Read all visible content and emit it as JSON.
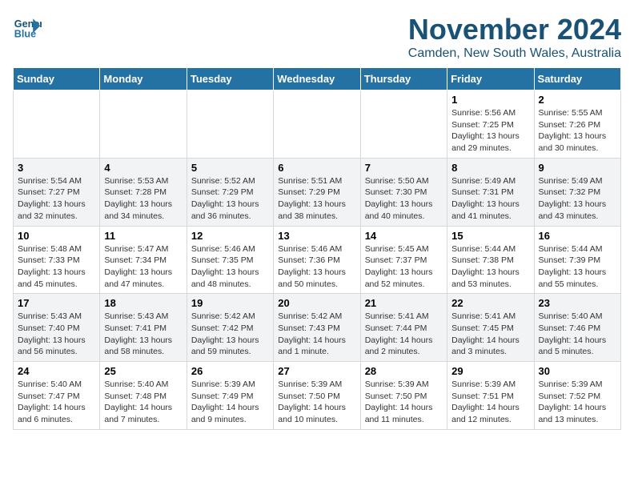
{
  "header": {
    "logo_line1": "General",
    "logo_line2": "Blue",
    "month": "November 2024",
    "location": "Camden, New South Wales, Australia"
  },
  "weekdays": [
    "Sunday",
    "Monday",
    "Tuesday",
    "Wednesday",
    "Thursday",
    "Friday",
    "Saturday"
  ],
  "weeks": [
    [
      {
        "day": "",
        "detail": ""
      },
      {
        "day": "",
        "detail": ""
      },
      {
        "day": "",
        "detail": ""
      },
      {
        "day": "",
        "detail": ""
      },
      {
        "day": "",
        "detail": ""
      },
      {
        "day": "1",
        "detail": "Sunrise: 5:56 AM\nSunset: 7:25 PM\nDaylight: 13 hours\nand 29 minutes."
      },
      {
        "day": "2",
        "detail": "Sunrise: 5:55 AM\nSunset: 7:26 PM\nDaylight: 13 hours\nand 30 minutes."
      }
    ],
    [
      {
        "day": "3",
        "detail": "Sunrise: 5:54 AM\nSunset: 7:27 PM\nDaylight: 13 hours\nand 32 minutes."
      },
      {
        "day": "4",
        "detail": "Sunrise: 5:53 AM\nSunset: 7:28 PM\nDaylight: 13 hours\nand 34 minutes."
      },
      {
        "day": "5",
        "detail": "Sunrise: 5:52 AM\nSunset: 7:29 PM\nDaylight: 13 hours\nand 36 minutes."
      },
      {
        "day": "6",
        "detail": "Sunrise: 5:51 AM\nSunset: 7:29 PM\nDaylight: 13 hours\nand 38 minutes."
      },
      {
        "day": "7",
        "detail": "Sunrise: 5:50 AM\nSunset: 7:30 PM\nDaylight: 13 hours\nand 40 minutes."
      },
      {
        "day": "8",
        "detail": "Sunrise: 5:49 AM\nSunset: 7:31 PM\nDaylight: 13 hours\nand 41 minutes."
      },
      {
        "day": "9",
        "detail": "Sunrise: 5:49 AM\nSunset: 7:32 PM\nDaylight: 13 hours\nand 43 minutes."
      }
    ],
    [
      {
        "day": "10",
        "detail": "Sunrise: 5:48 AM\nSunset: 7:33 PM\nDaylight: 13 hours\nand 45 minutes."
      },
      {
        "day": "11",
        "detail": "Sunrise: 5:47 AM\nSunset: 7:34 PM\nDaylight: 13 hours\nand 47 minutes."
      },
      {
        "day": "12",
        "detail": "Sunrise: 5:46 AM\nSunset: 7:35 PM\nDaylight: 13 hours\nand 48 minutes."
      },
      {
        "day": "13",
        "detail": "Sunrise: 5:46 AM\nSunset: 7:36 PM\nDaylight: 13 hours\nand 50 minutes."
      },
      {
        "day": "14",
        "detail": "Sunrise: 5:45 AM\nSunset: 7:37 PM\nDaylight: 13 hours\nand 52 minutes."
      },
      {
        "day": "15",
        "detail": "Sunrise: 5:44 AM\nSunset: 7:38 PM\nDaylight: 13 hours\nand 53 minutes."
      },
      {
        "day": "16",
        "detail": "Sunrise: 5:44 AM\nSunset: 7:39 PM\nDaylight: 13 hours\nand 55 minutes."
      }
    ],
    [
      {
        "day": "17",
        "detail": "Sunrise: 5:43 AM\nSunset: 7:40 PM\nDaylight: 13 hours\nand 56 minutes."
      },
      {
        "day": "18",
        "detail": "Sunrise: 5:43 AM\nSunset: 7:41 PM\nDaylight: 13 hours\nand 58 minutes."
      },
      {
        "day": "19",
        "detail": "Sunrise: 5:42 AM\nSunset: 7:42 PM\nDaylight: 13 hours\nand 59 minutes."
      },
      {
        "day": "20",
        "detail": "Sunrise: 5:42 AM\nSunset: 7:43 PM\nDaylight: 14 hours\nand 1 minute."
      },
      {
        "day": "21",
        "detail": "Sunrise: 5:41 AM\nSunset: 7:44 PM\nDaylight: 14 hours\nand 2 minutes."
      },
      {
        "day": "22",
        "detail": "Sunrise: 5:41 AM\nSunset: 7:45 PM\nDaylight: 14 hours\nand 3 minutes."
      },
      {
        "day": "23",
        "detail": "Sunrise: 5:40 AM\nSunset: 7:46 PM\nDaylight: 14 hours\nand 5 minutes."
      }
    ],
    [
      {
        "day": "24",
        "detail": "Sunrise: 5:40 AM\nSunset: 7:47 PM\nDaylight: 14 hours\nand 6 minutes."
      },
      {
        "day": "25",
        "detail": "Sunrise: 5:40 AM\nSunset: 7:48 PM\nDaylight: 14 hours\nand 7 minutes."
      },
      {
        "day": "26",
        "detail": "Sunrise: 5:39 AM\nSunset: 7:49 PM\nDaylight: 14 hours\nand 9 minutes."
      },
      {
        "day": "27",
        "detail": "Sunrise: 5:39 AM\nSunset: 7:50 PM\nDaylight: 14 hours\nand 10 minutes."
      },
      {
        "day": "28",
        "detail": "Sunrise: 5:39 AM\nSunset: 7:50 PM\nDaylight: 14 hours\nand 11 minutes."
      },
      {
        "day": "29",
        "detail": "Sunrise: 5:39 AM\nSunset: 7:51 PM\nDaylight: 14 hours\nand 12 minutes."
      },
      {
        "day": "30",
        "detail": "Sunrise: 5:39 AM\nSunset: 7:52 PM\nDaylight: 14 hours\nand 13 minutes."
      }
    ]
  ]
}
